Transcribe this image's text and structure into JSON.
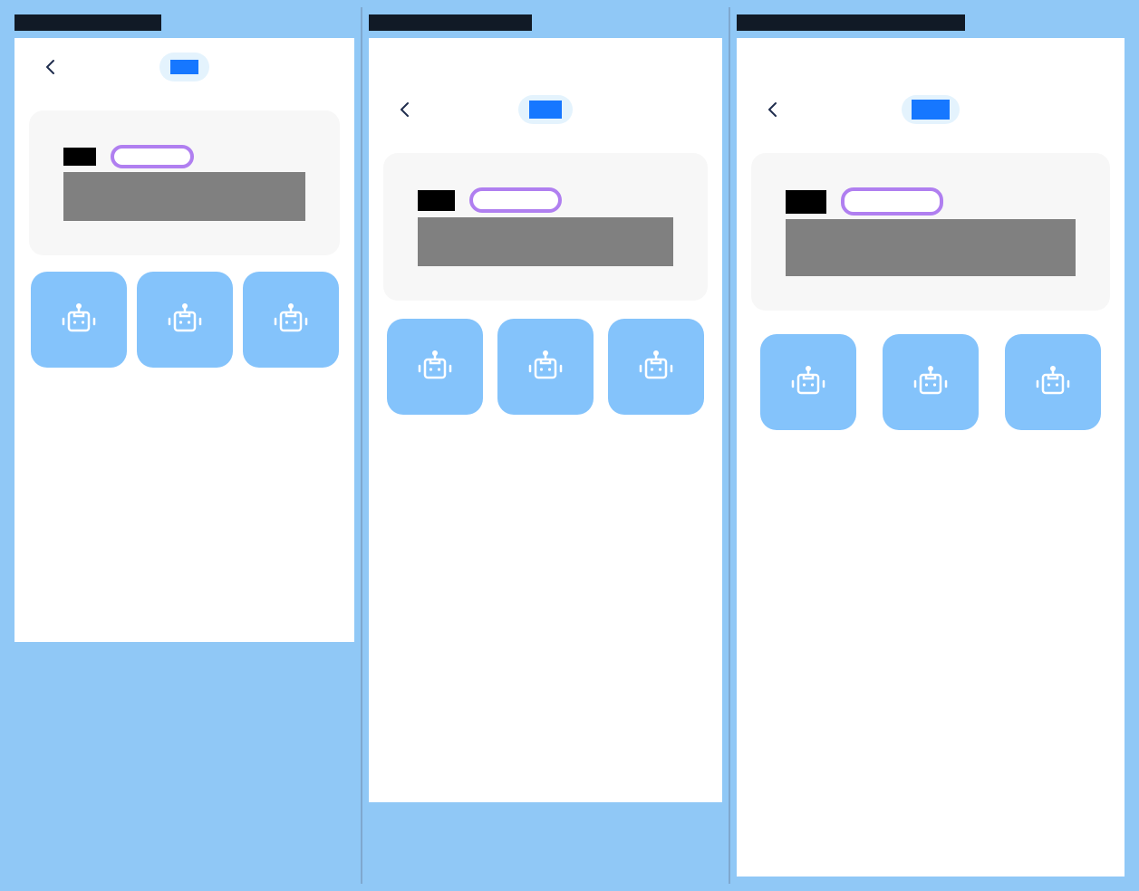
{
  "panels": [
    {
      "title": "",
      "back": {
        "icon": "chevron-left-icon"
      },
      "tab": {
        "label": ""
      },
      "card": {
        "label": "",
        "tag": "",
        "description": ""
      },
      "tiles": [
        {
          "icon": "robot-icon"
        },
        {
          "icon": "robot-icon"
        },
        {
          "icon": "robot-icon"
        }
      ]
    },
    {
      "title": "",
      "back": {
        "icon": "chevron-left-icon"
      },
      "tab": {
        "label": ""
      },
      "card": {
        "label": "",
        "tag": "",
        "description": ""
      },
      "tiles": [
        {
          "icon": "robot-icon"
        },
        {
          "icon": "robot-icon"
        },
        {
          "icon": "robot-icon"
        }
      ]
    },
    {
      "title": "",
      "back": {
        "icon": "chevron-left-icon"
      },
      "tab": {
        "label": ""
      },
      "card": {
        "label": "",
        "tag": "",
        "description": ""
      },
      "tiles": [
        {
          "icon": "robot-icon"
        },
        {
          "icon": "robot-icon"
        },
        {
          "icon": "robot-icon"
        }
      ]
    }
  ],
  "colors": {
    "background": "#90c8f6",
    "title_bar": "#111a26",
    "screen": "#ffffff",
    "accent_blue": "#1677ff",
    "tab_pill": "#e4f3fd",
    "card_bg": "#f7f7f7",
    "tag_border": "#b07ff0",
    "tile_bg": "#84c3fb",
    "chevron": "#1f2d4d"
  }
}
